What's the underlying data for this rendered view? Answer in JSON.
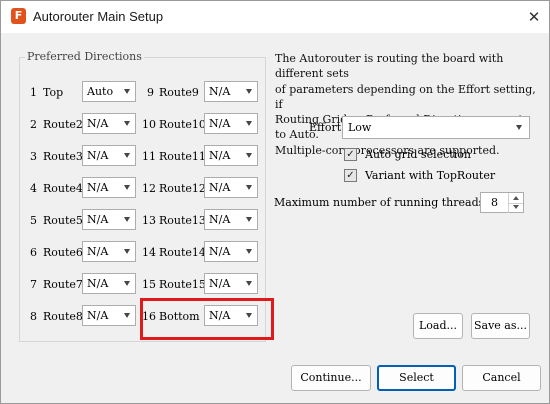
{
  "window": {
    "title": "Autorouter Main Setup",
    "app_icon": "F",
    "close_glyph": "✕"
  },
  "group": {
    "title": "Preferred Directions"
  },
  "rows": [
    {
      "num": "1",
      "name": "Top",
      "value": "Auto"
    },
    {
      "num": "2",
      "name": "Route2",
      "value": "N/A"
    },
    {
      "num": "3",
      "name": "Route3",
      "value": "N/A"
    },
    {
      "num": "4",
      "name": "Route4",
      "value": "N/A"
    },
    {
      "num": "5",
      "name": "Route5",
      "value": "N/A"
    },
    {
      "num": "6",
      "name": "Route6",
      "value": "N/A"
    },
    {
      "num": "7",
      "name": "Route7",
      "value": "N/A"
    },
    {
      "num": "8",
      "name": "Route8",
      "value": "N/A"
    },
    {
      "num": "9",
      "name": "Route9",
      "value": "N/A"
    },
    {
      "num": "10",
      "name": "Route10",
      "value": "N/A"
    },
    {
      "num": "11",
      "name": "Route11",
      "value": "N/A"
    },
    {
      "num": "12",
      "name": "Route12",
      "value": "N/A"
    },
    {
      "num": "13",
      "name": "Route13",
      "value": "N/A"
    },
    {
      "num": "14",
      "name": "Route14",
      "value": "N/A"
    },
    {
      "num": "15",
      "name": "Route15",
      "value": "N/A"
    },
    {
      "num": "16",
      "name": "Bottom",
      "value": "N/A"
    }
  ],
  "description": [
    "The Autorouter is routing the board with different sets",
    "of parameters depending on the Effort setting, if",
    "Routing Grid or Preferred Directions are set to Auto.",
    "Multiple-core processors are supported."
  ],
  "effort": {
    "label": "Effort",
    "value": "Low"
  },
  "options": {
    "auto_grid": {
      "label": "Auto grid selection",
      "checked": true
    },
    "variant_toprouter": {
      "label": "Variant with TopRouter",
      "checked": true
    }
  },
  "threads": {
    "label": "Maximum number of running threads",
    "value": "8"
  },
  "buttons": {
    "load": "Load...",
    "save_as": "Save as...",
    "continue": "Continue...",
    "select": "Select",
    "cancel": "Cancel"
  },
  "colors": {
    "highlight": "#e0191b",
    "accent": "#005fb8",
    "app_icon": "#e0531c"
  }
}
